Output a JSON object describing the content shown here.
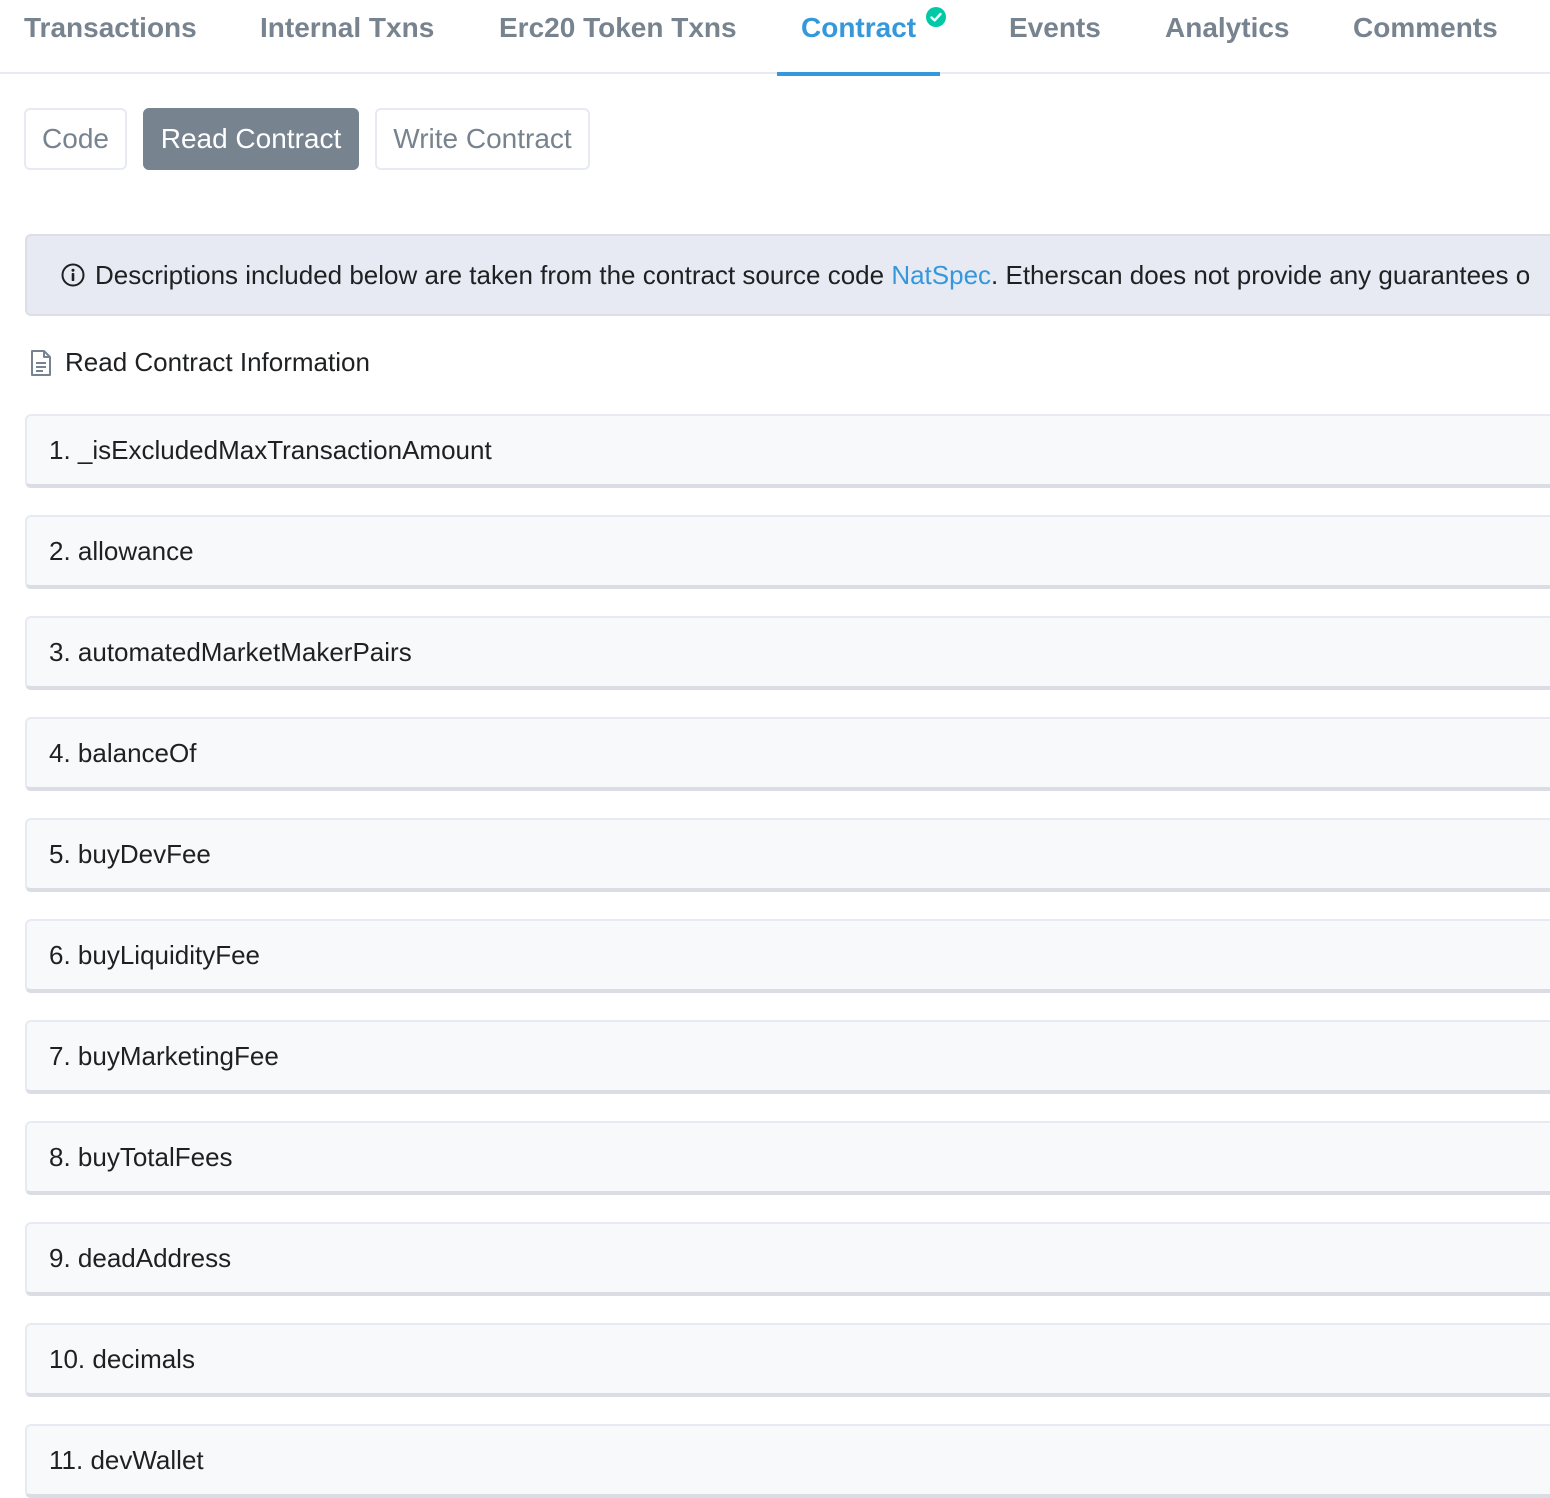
{
  "tabs": [
    {
      "label": "Transactions",
      "active": false
    },
    {
      "label": "Internal Txns",
      "active": false
    },
    {
      "label": "Erc20 Token Txns",
      "active": false
    },
    {
      "label": "Contract",
      "active": true,
      "verified_icon": "check-circle-icon"
    },
    {
      "label": "Events",
      "active": false
    },
    {
      "label": "Analytics",
      "active": false
    },
    {
      "label": "Comments",
      "active": false
    }
  ],
  "subtabs": [
    {
      "label": "Code",
      "active": false
    },
    {
      "label": "Read Contract",
      "active": true
    },
    {
      "label": "Write Contract",
      "active": false
    }
  ],
  "alert": {
    "icon": "info-circle-icon",
    "text_before": "Descriptions included below are taken from the contract source code ",
    "link": "NatSpec",
    "text_after": ". Etherscan does not provide any guarantees o"
  },
  "section": {
    "icon": "document-icon",
    "title": "Read Contract Information"
  },
  "functions": [
    "1. _isExcludedMaxTransactionAmount",
    "2. allowance",
    "3. automatedMarketMakerPairs",
    "4. balanceOf",
    "5. buyDevFee",
    "6. buyLiquidityFee",
    "7. buyMarketingFee",
    "8. buyTotalFees",
    "9. deadAddress",
    "10. decimals",
    "11. devWallet"
  ],
  "colors": {
    "accent": "#3498db",
    "verified": "#00c9a7",
    "muted": "#77838f"
  }
}
